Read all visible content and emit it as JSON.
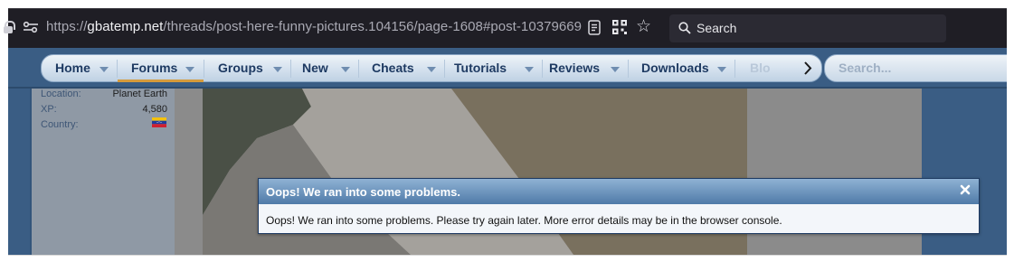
{
  "browser": {
    "url_prefix": "https://",
    "url_host": "gbatemp.net",
    "url_path": "/threads/post-here-funny-pictures.104156/page-1608#post-10379669",
    "search_placeholder": "Search",
    "icons": [
      "lock-icon",
      "tune-icon",
      "reader-view-icon",
      "qr-code-icon",
      "bookmark-star-icon",
      "search-icon"
    ]
  },
  "nav": {
    "items": [
      {
        "label": "Home"
      },
      {
        "label": "Forums"
      },
      {
        "label": "Groups"
      },
      {
        "label": "New"
      },
      {
        "label": "Cheats"
      },
      {
        "label": "Tutorials"
      },
      {
        "label": "Reviews"
      },
      {
        "label": "Downloads"
      },
      {
        "label": "Blo"
      }
    ],
    "search_placeholder": "Search...",
    "active_item": "Forums",
    "accent_color": "#d59b3c"
  },
  "user_info": {
    "location_label": "Location:",
    "location_value": "Planet Earth",
    "xp_label": "XP:",
    "xp_value": "4,580",
    "country_label": "Country:",
    "country_flag": "venezuela-flag-icon"
  },
  "dialog": {
    "title": "Oops! We ran into some problems.",
    "message": "Oops! We ran into some problems. Please try again later. More error details may be in the browser console.",
    "close_icon": "close-icon"
  },
  "colors": {
    "chrome_bg": "#1f1e25",
    "page_blue": "#3a5d84",
    "nav_text": "#1e3a62"
  }
}
